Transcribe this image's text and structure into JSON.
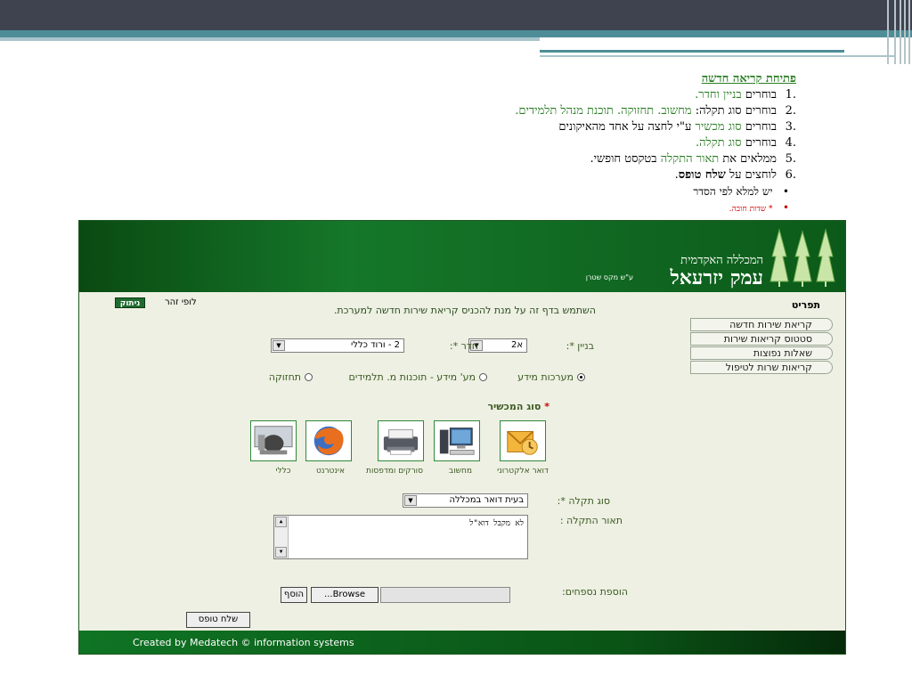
{
  "instructions": {
    "heading": "פתיחת קריאה חדשה",
    "steps": [
      {
        "num": ".1",
        "pre": "בוחרים ",
        "green": "בניין וחדר.",
        "post": ""
      },
      {
        "num": ".2",
        "pre": "בוחרים סוג תקלה: ",
        "green": "מחשוב. תחזוקה. תוכנת מנהל תלמידים.",
        "post": ""
      },
      {
        "num": ".3",
        "pre": "בוחרים ",
        "green": "סוג מכשיר",
        "post": " ע\"י לחצה על אחד מהאיקונים"
      },
      {
        "num": ".4",
        "pre": "בוחרים ",
        "green": "סוג תקלה.",
        "post": ""
      },
      {
        "num": ".5",
        "pre": "ממלאים את ",
        "green": "תאור התקלה",
        "post": " בטקסט חופשי."
      },
      {
        "num": ".6",
        "pre": "לוחצים על ",
        "bold": "שלח טופס",
        "post": "."
      }
    ],
    "bullet1": "יש למלא לפי הסדר",
    "bullet2": "* שדות חובה."
  },
  "app": {
    "header": {
      "small": "המכללה האקדמית",
      "big": "עמק יזרעאל",
      "sub": "ע\"ש מקס שטרן"
    },
    "menu": {
      "title": "תפריט",
      "items": [
        "קריאת שירות חדשה",
        "סטטוס קריאות שירות",
        "שאלות נפוצות",
        "קריאות שרות לטיפול"
      ]
    },
    "user": {
      "name": "לופי זהר",
      "logout": "ניתוק"
    },
    "intro": "השתמש בדף זה על מנת להכניס קריאת שירות חדשה למערכת.",
    "building": {
      "label": "בניין *:",
      "value": "א2"
    },
    "room": {
      "label": "חדר *:",
      "value": "2 - ורוד כללי"
    },
    "categories": [
      {
        "label": "מערכות מידע",
        "selected": true
      },
      {
        "label": "מע' מידע - תוכנות מ. תלמידים",
        "selected": false
      },
      {
        "label": "תחזוקה",
        "selected": false
      }
    ],
    "device_title": "סוג המכשיר",
    "device_star": "*",
    "devices": [
      {
        "label": "דואר אלקטרוני",
        "icon": "email-icon"
      },
      {
        "label": "מחשוב",
        "icon": "computer-icon"
      },
      {
        "label": "סורקים ומדפסות",
        "icon": "printer-icon"
      },
      {
        "label": "אינטרנט",
        "icon": "firefox-icon"
      },
      {
        "label": "כללי",
        "icon": "general-icon"
      }
    ],
    "fault_type": {
      "label": "סוג תקלה *:",
      "value": "בעית דואר במכללה"
    },
    "description": {
      "label": "תאור התקלה :",
      "value": "לא מקבל דוא\"ל"
    },
    "attachments": {
      "label": "הוספת נספחים:",
      "browse": "Browse...",
      "add": "הוסף"
    },
    "submit": "שלח טופס",
    "footer": "Created by Medatech © information systems"
  },
  "colors": {
    "accent_green": "#2a7d24",
    "header_green": "#15772a",
    "app_bg": "#edf0e2"
  }
}
